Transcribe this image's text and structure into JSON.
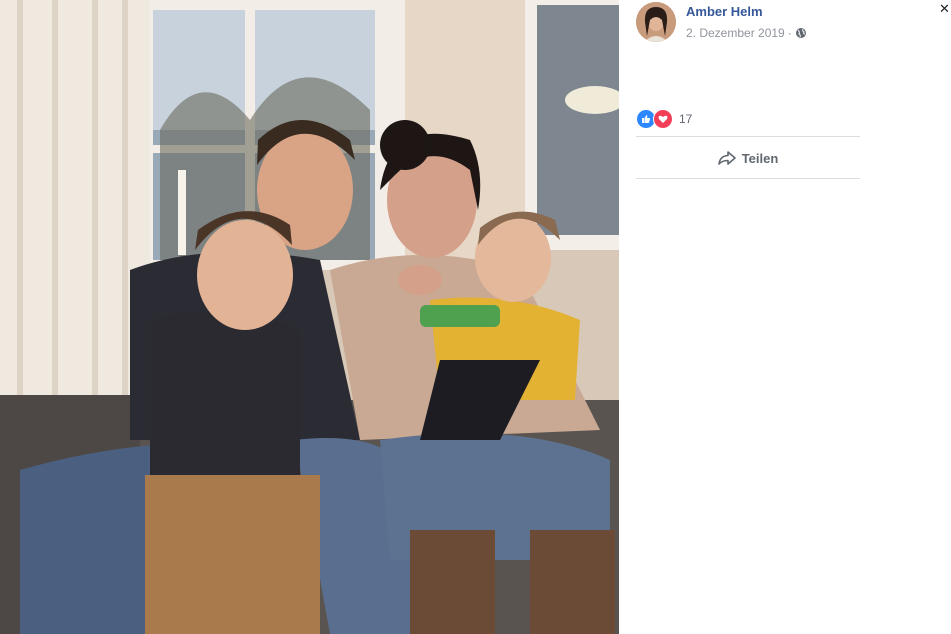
{
  "post": {
    "author": "Amber Helm",
    "date": "2. Dezember 2019",
    "separator": "·",
    "privacy_icon": "globe-icon"
  },
  "reactions": {
    "icons": [
      "like-icon",
      "love-icon"
    ],
    "count": "17"
  },
  "actions": {
    "share_label": "Teilen",
    "share_icon": "share-arrow-icon"
  },
  "colors": {
    "author_link": "#365899",
    "like": "#2d88ff",
    "love": "#f33e58",
    "meta_text": "#90949c"
  }
}
